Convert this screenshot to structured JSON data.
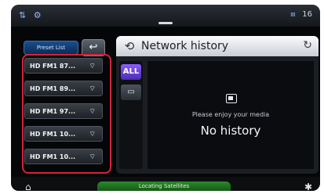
{
  "status": {
    "left_icons": "⇅ ⚙",
    "right_text": "16"
  },
  "presets": {
    "header_label": "Preset List",
    "back_icon": "↩",
    "items": [
      {
        "label": "HD FM1 87..."
      },
      {
        "label": "HD FM1 89..."
      },
      {
        "label": "HD FM1 97..."
      },
      {
        "label": "HD FM1 10..."
      },
      {
        "label": "HD FM1 10..."
      }
    ]
  },
  "panel": {
    "title": "Network history",
    "tabs": {
      "all": "ALL",
      "media_icon": "▭"
    },
    "message": "Please enjoy your media",
    "empty_label": "No history"
  },
  "bottom": {
    "status_text": "Locating Satellites",
    "left_icon": "⌂",
    "right_icon": "✱"
  },
  "colors": {
    "highlight": "#d6223a",
    "accent_tab": "#6a3fe0",
    "status_bar": "#2d8a2a"
  }
}
